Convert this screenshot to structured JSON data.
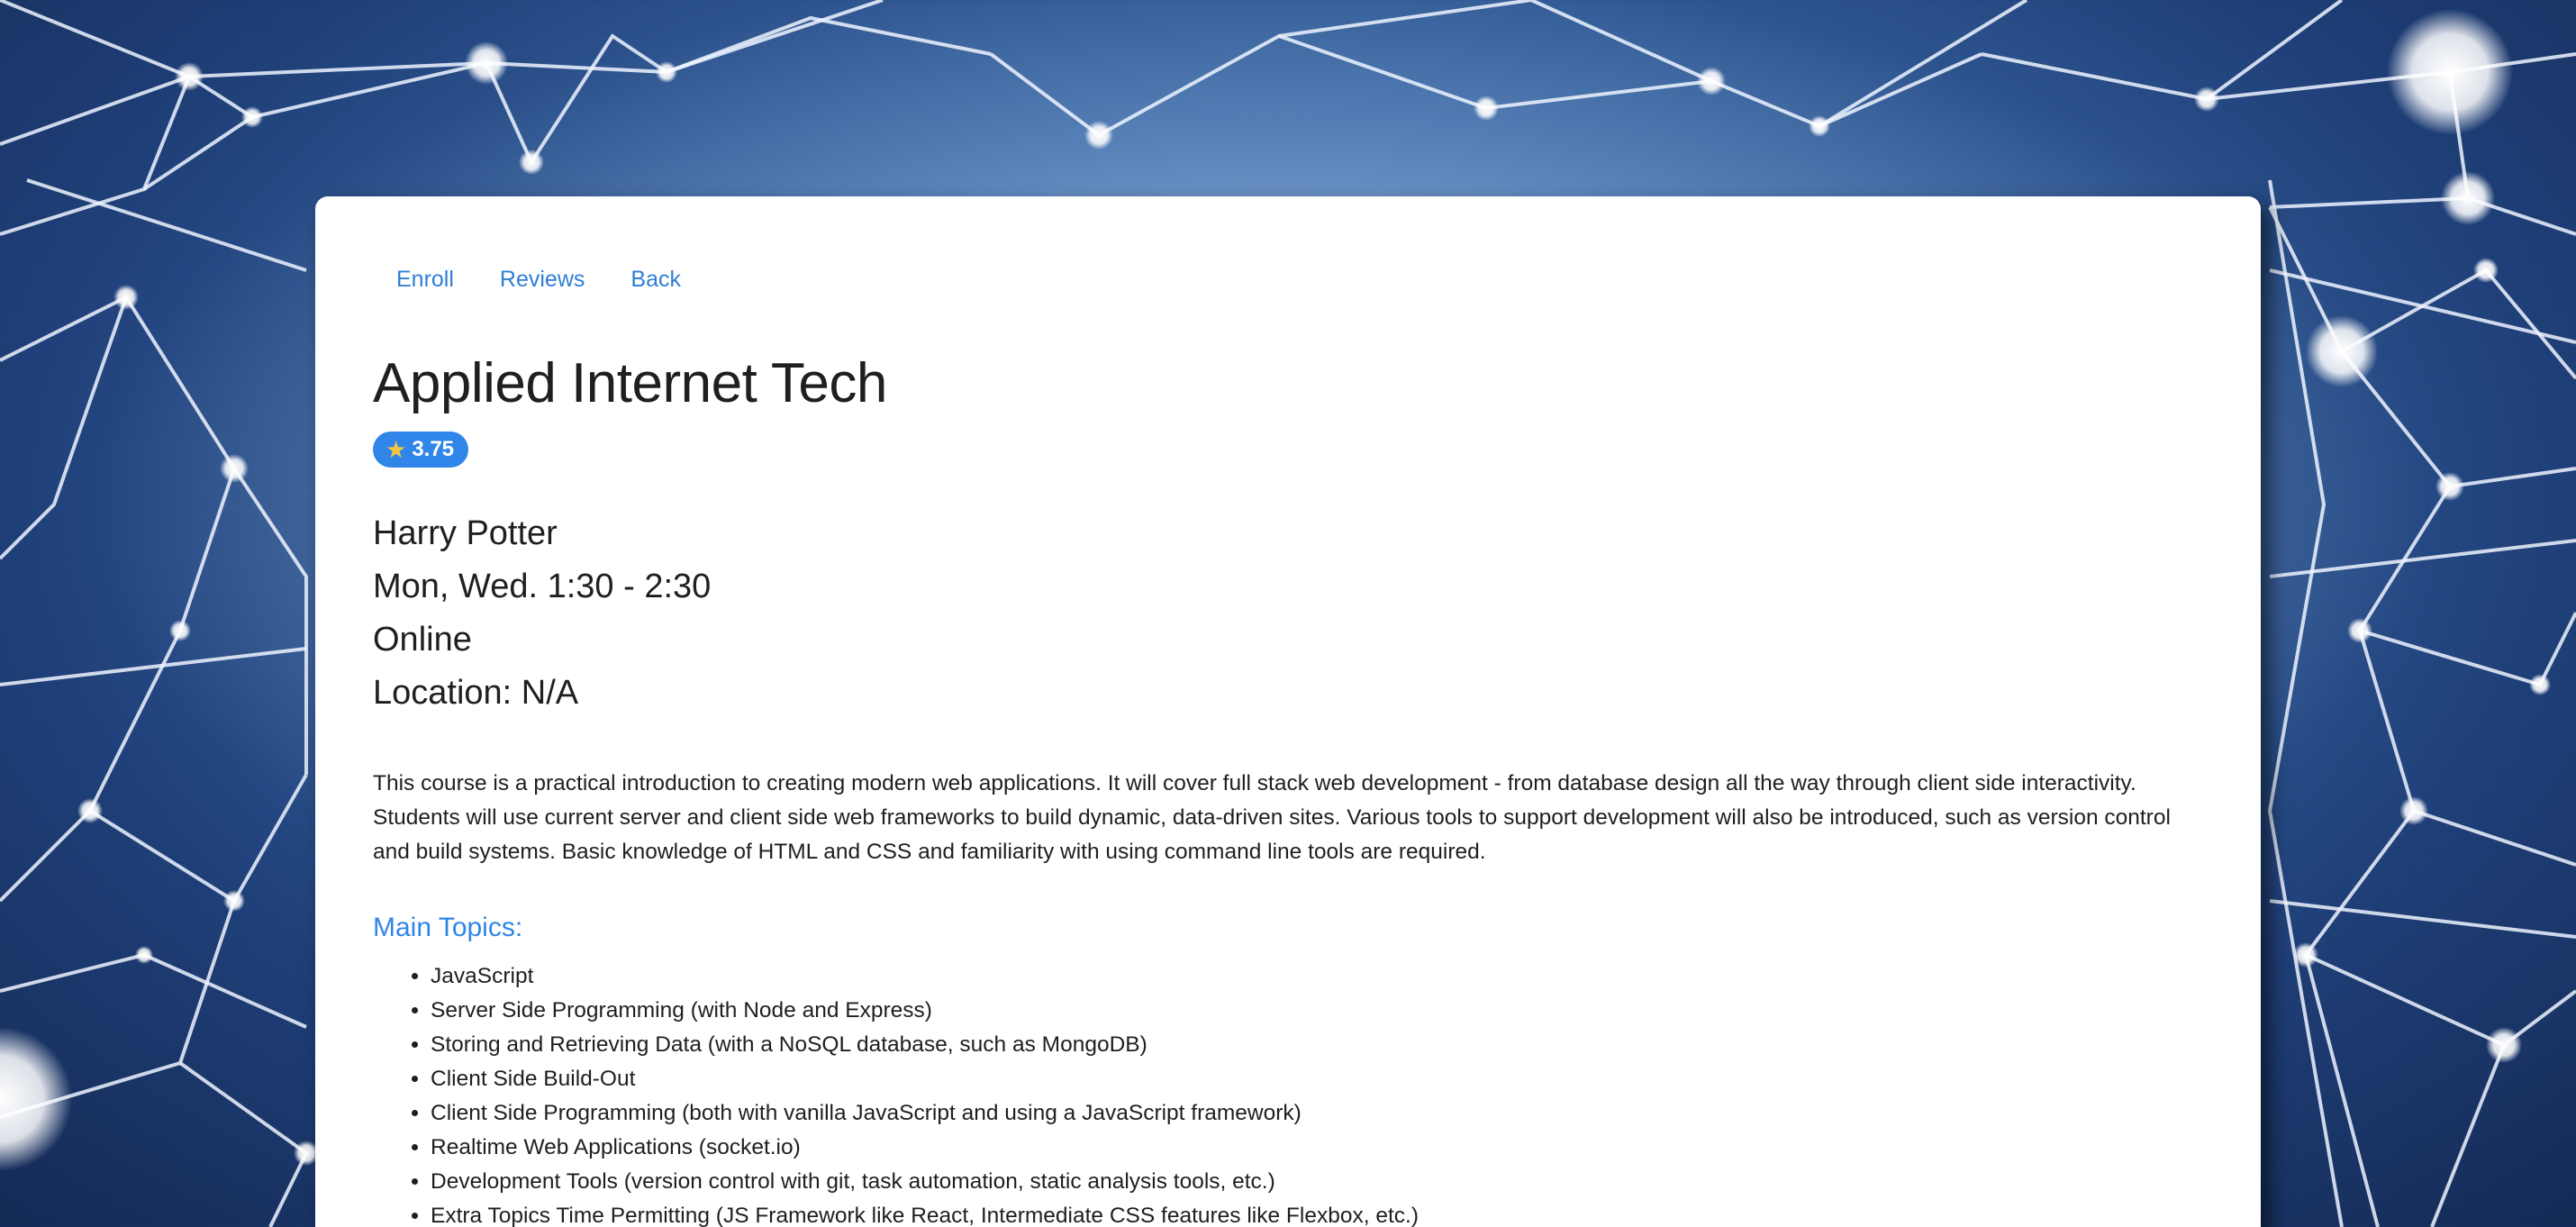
{
  "nav": {
    "enroll": "Enroll",
    "reviews": "Reviews",
    "back": "Back"
  },
  "course": {
    "title": "Applied Internet Tech",
    "rating": "3.75",
    "instructor": "Harry Potter",
    "schedule": "Mon, Wed. 1:30 - 2:30",
    "mode": "Online",
    "location": "Location: N/A",
    "description": "This course is a practical introduction to creating modern web applications. It will cover full stack web development - from database design all the way through client side interactivity. Students will use current server and client side web frameworks to build dynamic, data-driven sites. Various tools to support development will also be introduced, such as version control and build systems. Basic knowledge of HTML and CSS and familiarity with using command line tools are required."
  },
  "topics": {
    "heading": "Main Topics:",
    "items": [
      "JavaScript",
      "Server Side Programming (with Node and Express)",
      "Storing and Retrieving Data (with a NoSQL database, such as MongoDB)",
      "Client Side Build-Out",
      "Client Side Programming (both with vanilla JavaScript and using a JavaScript framework)",
      "Realtime Web Applications (socket.io)",
      "Development Tools (version control with git, task automation, static analysis tools, etc.)",
      "Extra Topics Time Permitting (JS Framework like React, Intermediate CSS features like Flexbox, etc.)"
    ]
  },
  "icons": {
    "rating": "star-icon"
  },
  "colors": {
    "link": "#2f7fd6",
    "badge": "#2f86e8",
    "star": "#f5c542"
  }
}
